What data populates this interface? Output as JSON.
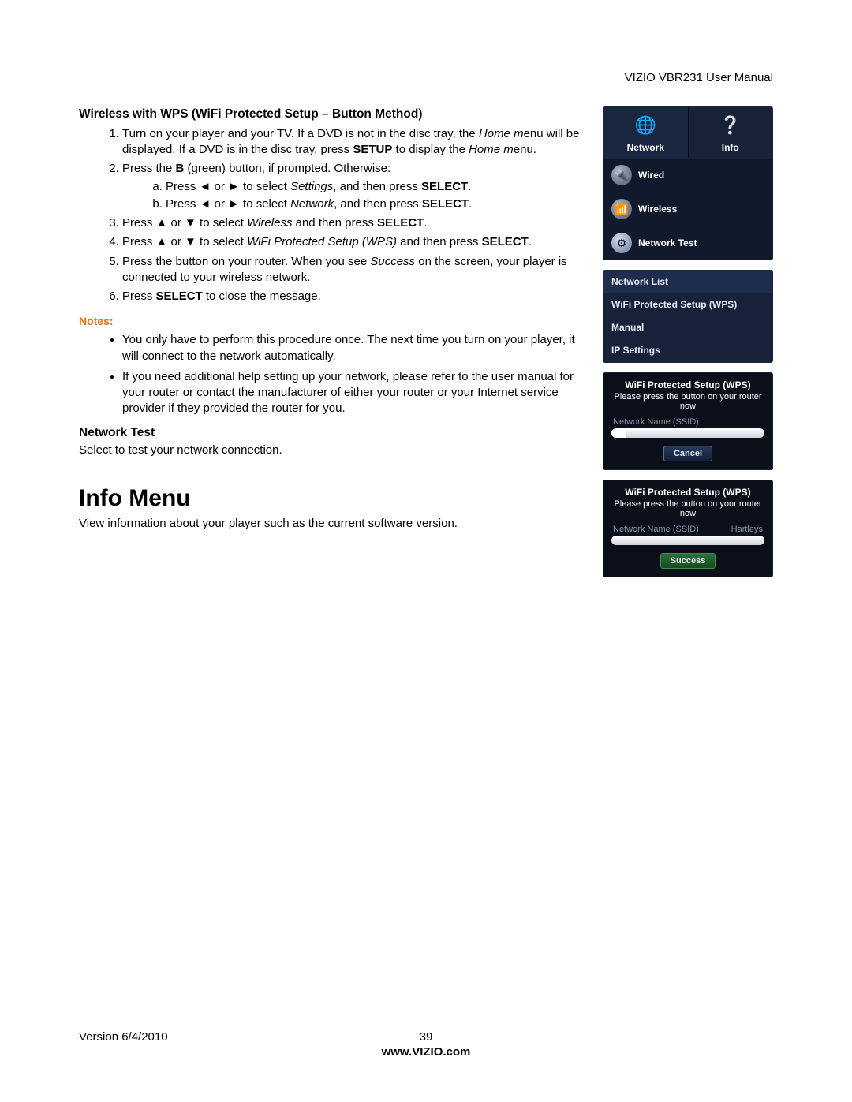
{
  "doc_header": "VIZIO VBR231 User Manual",
  "section": {
    "title": "Wireless with WPS (WiFi Protected Setup – Button Method)",
    "step1": "Turn on your player and your TV. If a DVD is not in the disc tray, the ",
    "step1_em": "Home m",
    "step1_b": "enu will be displayed. If a DVD is in the disc tray, press ",
    "step1_setup": "SETUP",
    "step1_c": " to display the ",
    "step1_em2": "Home m",
    "step1_d": "enu.",
    "step2_a": "Press the ",
    "step2_b": "B",
    "step2_c": " (green) button, if prompted. Otherwise:",
    "step2a_a": "Press ◄ or ► to select ",
    "step2a_em": "Settings",
    "step2a_b": ", and then press ",
    "step2a_bold": "SELECT",
    "step2a_c": ".",
    "step2b_a": "Press ◄ or ► to select ",
    "step2b_em": "Network",
    "step2b_b": ", and then press ",
    "step2b_bold": "SELECT",
    "step2b_c": ".",
    "step3_a": "Press ▲ or ▼ to select ",
    "step3_em": "Wireless",
    "step3_b": " and then press ",
    "step3_bold": "SELECT",
    "step3_c": ".",
    "step4_a": "Press ▲ or ▼ to select ",
    "step4_em": "WiFi Protected Setup (WPS)",
    "step4_b": " and then press ",
    "step4_bold": "SELECT",
    "step4_c": ".",
    "step5_a": "Press the button on your router. When you see ",
    "step5_em": "Success",
    "step5_b": " on the screen, your player is connected to your wireless network.",
    "step6_a": "Press ",
    "step6_bold": "SELECT",
    "step6_b": " to close the message."
  },
  "notes_label": "Notes:",
  "notes": {
    "n1": "You only have to perform this procedure once. The next time you turn on your player, it will connect to the network automatically.",
    "n2": "If you need additional help setting up your network, please refer to the user manual for your router or contact the manufacturer of either your router or your Internet service provider if they provided the router for you."
  },
  "network_test": {
    "title": "Network Test",
    "body": "Select to test your network connection."
  },
  "info_menu": {
    "title": "Info Menu",
    "body": "View information about your player such as the current software version."
  },
  "ss1": {
    "tab1": "Network",
    "tab2": "Info",
    "items": [
      "Wired",
      "Wireless",
      "Network Test"
    ]
  },
  "ss2": {
    "rows": [
      "Network List",
      "WiFi Protected Setup (WPS)",
      "Manual",
      "IP Settings"
    ]
  },
  "ss3": {
    "t1": "WiFi Protected Setup (WPS)",
    "t2": "Please press the button on your router now",
    "field": "Network Name (SSID)",
    "btn": "Cancel"
  },
  "ss4": {
    "t1": "WiFi Protected Setup (WPS)",
    "t2": "Please press the button on your router now",
    "field_l": "Network Name (SSID)",
    "field_r": "Hartleys",
    "btn": "Success"
  },
  "footer": {
    "version": "Version 6/4/2010",
    "page": "39",
    "url": "www.VIZIO.com"
  }
}
